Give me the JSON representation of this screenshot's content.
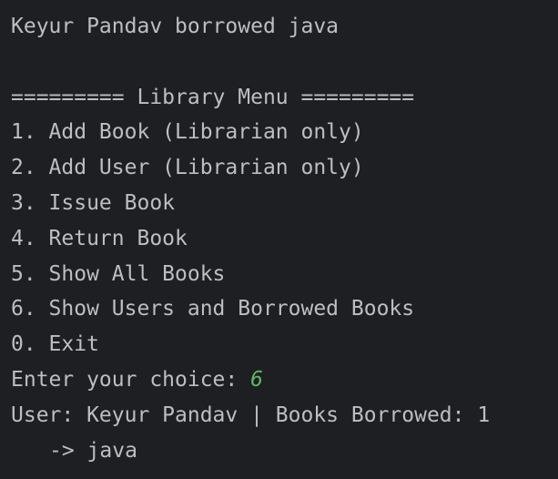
{
  "console": {
    "borrow_message": "Keyur Pandav borrowed java",
    "menu_header": "========= Library Menu =========",
    "menu_items": [
      "1. Add Book (Librarian only)",
      "2. Add User (Librarian only)",
      "3. Issue Book",
      "4. Return Book",
      "5. Show All Books",
      "6. Show Users and Borrowed Books",
      "0. Exit"
    ],
    "prompt": "Enter your choice: ",
    "user_input": "6",
    "user_summary": "User: Keyur Pandav | Books Borrowed: 1",
    "borrowed_book": "-> java"
  },
  "colors": {
    "background": "#1e1f22",
    "text": "#bcbec4",
    "user_input": "#5fb865"
  }
}
